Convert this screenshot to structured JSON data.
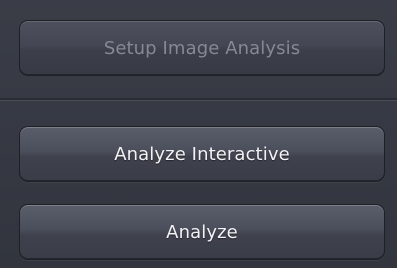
{
  "setup_section": {
    "setup_image_analysis_label": "Setup Image Analysis",
    "setup_image_analysis_enabled": false
  },
  "analysis_section": {
    "analyze_interactive_label": "Analyze Interactive",
    "analyze_label": "Analyze"
  },
  "colors": {
    "panel_background": "#363943",
    "button_text": "#f2f2f4",
    "button_text_disabled": "#858996"
  }
}
